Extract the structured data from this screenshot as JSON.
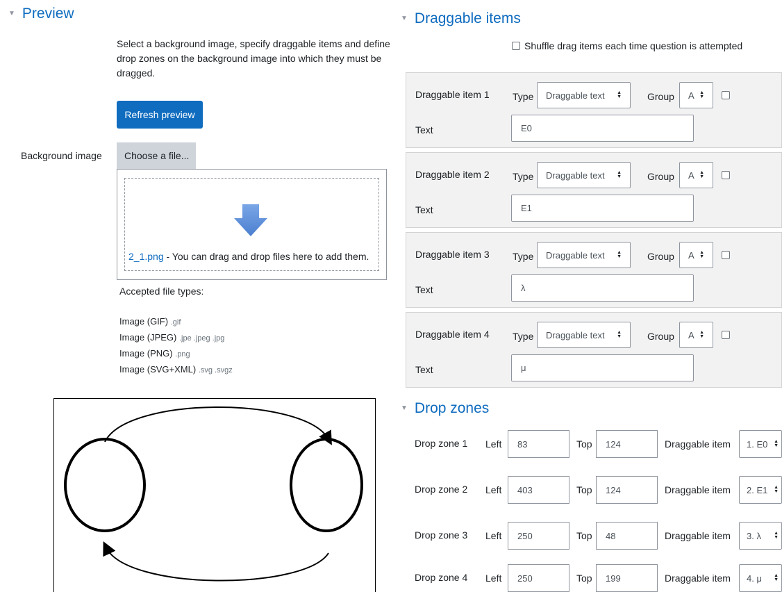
{
  "preview": {
    "heading": "Preview",
    "instructions": "Select a background image, specify draggable items and define drop zones on the background image into which they must be dragged.",
    "refresh_button": "Refresh preview",
    "background_label": "Background image",
    "choose_file": "Choose a file...",
    "uploaded_file": "2_1.png",
    "drop_hint": " - You can drag and drop files here to add them.",
    "accepted_label": "Accepted file types:",
    "file_types": [
      {
        "name": "Image (GIF)",
        "ext": ".gif"
      },
      {
        "name": "Image (JPEG)",
        "ext": ".jpe .jpeg .jpg"
      },
      {
        "name": "Image (PNG)",
        "ext": ".png"
      },
      {
        "name": "Image (SVG+XML)",
        "ext": ".svg .svgz"
      }
    ]
  },
  "draggable": {
    "heading": "Draggable items",
    "shuffle_label": "Shuffle drag items each time question is attempted",
    "type_label": "Type",
    "group_label": "Group",
    "text_label": "Text",
    "items": [
      {
        "label": "Draggable item 1",
        "type": "Draggable text",
        "group": "A",
        "text": "E0"
      },
      {
        "label": "Draggable item 2",
        "type": "Draggable text",
        "group": "A",
        "text": "E1"
      },
      {
        "label": "Draggable item 3",
        "type": "Draggable text",
        "group": "A",
        "text": "λ"
      },
      {
        "label": "Draggable item 4",
        "type": "Draggable text",
        "group": "A",
        "text": "μ"
      }
    ]
  },
  "dropzones": {
    "heading": "Drop zones",
    "left_label": "Left",
    "top_label": "Top",
    "item_label": "Draggable item",
    "zones": [
      {
        "label": "Drop zone 1",
        "left": "83",
        "top": "124",
        "item": "1. E0"
      },
      {
        "label": "Drop zone 2",
        "left": "403",
        "top": "124",
        "item": "2. E1"
      },
      {
        "label": "Drop zone 3",
        "left": "250",
        "top": "48",
        "item": "3. λ"
      },
      {
        "label": "Drop zone 4",
        "left": "250",
        "top": "199",
        "item": "4. μ"
      }
    ]
  },
  "icons": {
    "collapse": "triangle-down",
    "select_arrow": "up-down-arrows",
    "upload": "arrow-down"
  },
  "colors": {
    "accent": "#0f6cbf",
    "upload_arrow": "#5b8ed6"
  }
}
